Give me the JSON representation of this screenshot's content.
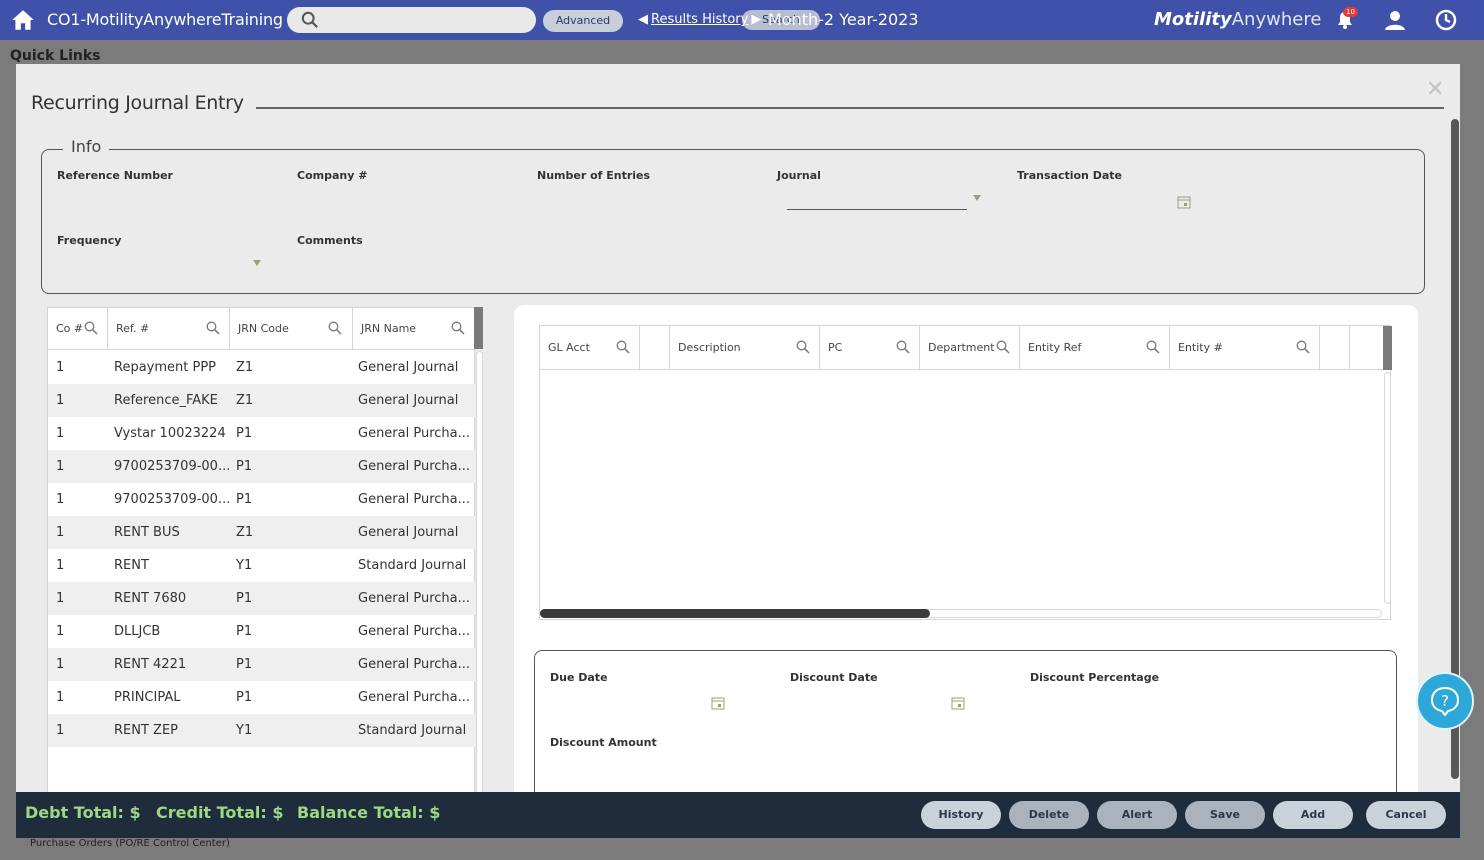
{
  "topbar": {
    "app_title": "CO1-MotilityAnywhereTraining",
    "search_placeholder": "",
    "search_label": "Search",
    "advanced_label": "Advanced",
    "results_history": "Results History",
    "period": "Month-2 Year-2023",
    "brand_bold": "Motility",
    "brand_light": "Anywhere",
    "notification_count": "10",
    "accent_color": "#3f51a8"
  },
  "background": {
    "quick_links": "Quick Links",
    "purchase_orders": "Purchase Orders (PO/RE Control Center)"
  },
  "modal": {
    "title": "Recurring Journal Entry",
    "info_legend": "Info",
    "fields": {
      "reference_number": "Reference Number",
      "company": "Company #",
      "number_of_entries": "Number of Entries",
      "journal": "Journal",
      "transaction_date": "Transaction Date",
      "frequency": "Frequency",
      "comments": "Comments"
    },
    "left_grid": {
      "columns": [
        "Co #",
        "Ref. #",
        "JRN Code",
        "JRN Name"
      ],
      "rows": [
        [
          "1",
          "Repayment PPP",
          "Z1",
          "General Journal"
        ],
        [
          "1",
          "Reference_FAKE",
          "Z1",
          "General Journal"
        ],
        [
          "1",
          "Vystar 10023224",
          "P1",
          "General Purcha..."
        ],
        [
          "1",
          "9700253709-00...",
          "P1",
          "General Purcha..."
        ],
        [
          "1",
          "9700253709-00...",
          "P1",
          "General Purcha..."
        ],
        [
          "1",
          "RENT BUS",
          "Z1",
          "General Journal"
        ],
        [
          "1",
          "RENT",
          "Y1",
          "Standard Journal"
        ],
        [
          "1",
          "RENT 7680",
          "P1",
          "General Purcha..."
        ],
        [
          "1",
          "DLLJCB",
          "P1",
          "General Purcha..."
        ],
        [
          "1",
          "RENT 4221",
          "P1",
          "General Purcha..."
        ],
        [
          "1",
          "PRINCIPAL",
          "P1",
          "General Purcha..."
        ],
        [
          "1",
          "RENT ZEP",
          "Y1",
          "Standard Journal"
        ]
      ]
    },
    "right_grid": {
      "columns": [
        "GL Acct",
        "",
        "Description",
        "PC",
        "Department",
        "Entity Ref",
        "Entity #",
        ""
      ]
    },
    "detail": {
      "due_date": "Due Date",
      "discount_date": "Discount Date",
      "discount_percentage": "Discount Percentage",
      "discount_amount": "Discount Amount"
    }
  },
  "footer": {
    "debt_total": "Debt Total: $",
    "credit_total": "Credit Total: $",
    "balance_total": "Balance Total: $",
    "buttons": {
      "history": "History",
      "delete": "Delete",
      "alert": "Alert",
      "save": "Save",
      "add": "Add",
      "cancel": "Cancel"
    },
    "total_color": "#9ed883"
  }
}
